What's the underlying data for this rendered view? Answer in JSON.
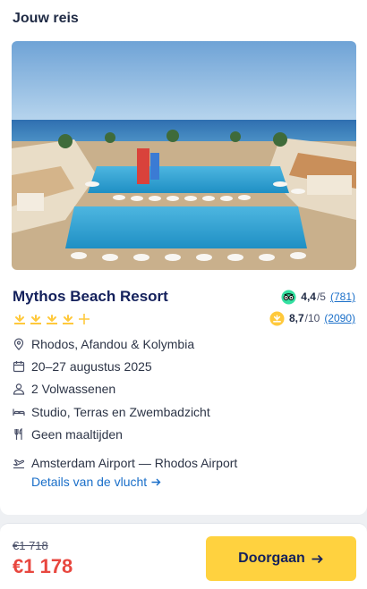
{
  "section_title": "Jouw reis",
  "hotel": {
    "name": "Mythos Beach Resort",
    "stars": 4,
    "plus_star": true,
    "image_alt": "Mythos Beach Resort"
  },
  "ratings": {
    "tripadvisor": {
      "score": "4,4",
      "max": "/5",
      "count": "(781)",
      "icon": "tripadvisor-icon",
      "color": "#34e0a1"
    },
    "sunweb": {
      "score": "8,7",
      "max": "/10",
      "count": "(2090)",
      "icon": "sunweb-rating-icon",
      "color": "#ffc93c"
    }
  },
  "details": {
    "location": "Rhodos, Afandou & Kolymbia",
    "dates": "20–27 augustus 2025",
    "travellers": "2 Volwassenen",
    "room": "Studio, Terras en Zwembadzicht",
    "board": "Geen maaltijden",
    "flight": "Amsterdam Airport — Rhodos Airport",
    "flight_link": "Details van de vlucht"
  },
  "footer": {
    "old_price": "€1 718",
    "new_price": "€1 178",
    "cta_label": "Doorgaan"
  },
  "colors": {
    "accent_yellow": "#ffd23f",
    "price_red": "#e8473f",
    "link_blue": "#1a6fc9",
    "navy": "#14215c"
  }
}
